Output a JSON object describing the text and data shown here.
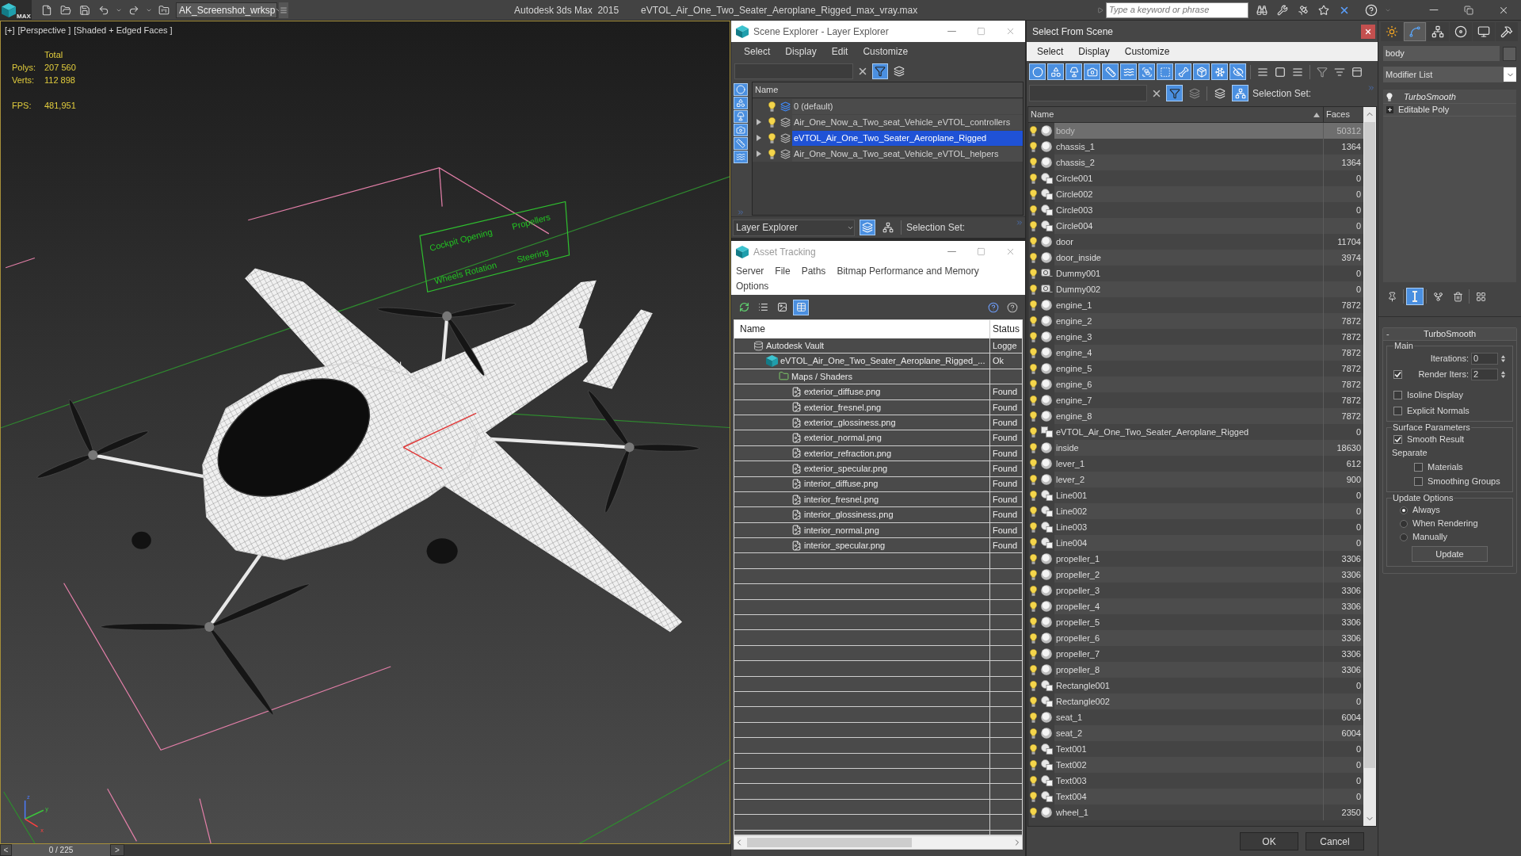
{
  "title_bar": {
    "logo": "MAX",
    "workspace": "AK_Screenshot_wrksp",
    "app_title": "Autodesk 3ds Max  2015",
    "file_title": "eVTOL_Air_One_Two_Seater_Aeroplane_Rigged_max_vray.max",
    "search": {
      "placeholder": "Type a keyword or phrase"
    }
  },
  "viewport": {
    "labels": [
      "[+]",
      "[Perspective ]",
      "[Shaded + Edged Faces ]"
    ],
    "stats": {
      "heading": "Total",
      "rows": [
        {
          "label": "Polys:",
          "value": "207 560"
        },
        {
          "label": "Verts:",
          "value": "112 898"
        }
      ],
      "fps": {
        "label": "FPS:",
        "value": "481,951"
      }
    },
    "rig_labels": [
      "Cockpit Opening",
      "Propellers",
      "Wheels Rotation",
      "Steering"
    ],
    "axis_labels": [
      "z",
      "y",
      "x"
    ]
  },
  "time_slider": {
    "prev": "<",
    "position": "0 / 225",
    "next": ">"
  },
  "scene_explorer": {
    "title": "Scene Explorer - Layer Explorer",
    "menu": [
      "Select",
      "Display",
      "Edit",
      "Customize"
    ],
    "filter_on": true,
    "type_filters": [
      {
        "on": true
      },
      {
        "on": true
      },
      {
        "on": true
      },
      {
        "on": true
      },
      {
        "on": true
      },
      {
        "on": true
      }
    ],
    "column": "Name",
    "layers": [
      {
        "name": "0 (default)",
        "expandable": false,
        "current": true,
        "selected": false
      },
      {
        "name": "Air_One_Now_a_Two_seat_Vehicle_eVTOL_controllers",
        "expandable": true,
        "current": false,
        "selected": false
      },
      {
        "name": "eVTOL_Air_One_Two_Seater_Aeroplane_Rigged",
        "expandable": true,
        "current": false,
        "selected": true
      },
      {
        "name": "Air_One_Now_a_Two_seat_Vehicle_eVTOL_helpers",
        "expandable": true,
        "current": false,
        "selected": false
      }
    ],
    "explorer_mode": "Layer Explorer",
    "view_toggles": [
      {
        "on": true
      },
      {
        "on": false
      }
    ],
    "selection_set": "Selection Set:"
  },
  "asset_tracking": {
    "title": "Asset Tracking",
    "menu": [
      "Server",
      "File",
      "Paths",
      "Bitmap Performance and Memory",
      "Options"
    ],
    "view_modes": [
      {
        "selected": false
      },
      {
        "selected": false
      },
      {
        "selected": true
      }
    ],
    "columns": [
      "Name",
      "Status"
    ],
    "tree": [
      {
        "kind": "vault",
        "name": "Autodesk Vault",
        "status": "Logge",
        "children": [
          {
            "kind": "scene",
            "name": "eVTOL_Air_One_Two_Seater_Aeroplane_Rigged_...",
            "status": "Ok",
            "children": [
              {
                "kind": "folder",
                "name": "Maps / Shaders",
                "children": [
                  {
                    "kind": "bitmap",
                    "name": "exterior_diffuse.png",
                    "status": "Found"
                  },
                  {
                    "kind": "bitmap",
                    "name": "exterior_fresnel.png",
                    "status": "Found"
                  },
                  {
                    "kind": "bitmap",
                    "name": "exterior_glossiness.png",
                    "status": "Found"
                  },
                  {
                    "kind": "bitmap",
                    "name": "exterior_normal.png",
                    "status": "Found"
                  },
                  {
                    "kind": "bitmap",
                    "name": "exterior_refraction.png",
                    "status": "Found"
                  },
                  {
                    "kind": "bitmap",
                    "name": "exterior_specular.png",
                    "status": "Found"
                  },
                  {
                    "kind": "bitmap",
                    "name": "interior_diffuse.png",
                    "status": "Found"
                  },
                  {
                    "kind": "bitmap",
                    "name": "interior_fresnel.png",
                    "status": "Found"
                  },
                  {
                    "kind": "bitmap",
                    "name": "interior_glossiness.png",
                    "status": "Found"
                  },
                  {
                    "kind": "bitmap",
                    "name": "interior_normal.png",
                    "status": "Found"
                  },
                  {
                    "kind": "bitmap",
                    "name": "interior_specular.png",
                    "status": "Found"
                  }
                ]
              }
            ]
          }
        ]
      }
    ]
  },
  "select_from_scene": {
    "title": "Select From Scene",
    "menu": [
      "Select",
      "Display",
      "Customize"
    ],
    "type_filters": [
      {
        "on": true
      },
      {
        "on": true
      },
      {
        "on": true
      },
      {
        "on": true
      },
      {
        "on": true
      },
      {
        "on": true
      },
      {
        "on": true
      },
      {
        "on": true
      },
      {
        "on": true
      },
      {
        "on": true
      },
      {
        "on": true
      },
      {
        "on": true
      }
    ],
    "toggles": [
      {
        "on": true
      },
      {
        "on": false
      },
      {
        "on": true
      }
    ],
    "selection_set": "Selection Set:",
    "columns": [
      "Name",
      "Faces"
    ],
    "rows": [
      {
        "name": "body",
        "faces": "50312",
        "kind": "geometry",
        "selected": true
      },
      {
        "name": "chassis_1",
        "faces": "1364",
        "kind": "geometry",
        "selected": false
      },
      {
        "name": "chassis_2",
        "faces": "1364",
        "kind": "geometry",
        "selected": false
      },
      {
        "name": "Circle001",
        "faces": "0",
        "kind": "shape",
        "selected": false
      },
      {
        "name": "Circle002",
        "faces": "0",
        "kind": "shape",
        "selected": false
      },
      {
        "name": "Circle003",
        "faces": "0",
        "kind": "shape",
        "selected": false
      },
      {
        "name": "Circle004",
        "faces": "0",
        "kind": "shape",
        "selected": false
      },
      {
        "name": "door",
        "faces": "11704",
        "kind": "geometry",
        "selected": false
      },
      {
        "name": "door_inside",
        "faces": "3974",
        "kind": "geometry",
        "selected": false
      },
      {
        "name": "Dummy001",
        "faces": "0",
        "kind": "helper",
        "selected": false
      },
      {
        "name": "Dummy002",
        "faces": "0",
        "kind": "helper",
        "selected": false
      },
      {
        "name": "engine_1",
        "faces": "7872",
        "kind": "geometry",
        "selected": false
      },
      {
        "name": "engine_2",
        "faces": "7872",
        "kind": "geometry",
        "selected": false
      },
      {
        "name": "engine_3",
        "faces": "7872",
        "kind": "geometry",
        "selected": false
      },
      {
        "name": "engine_4",
        "faces": "7872",
        "kind": "geometry",
        "selected": false
      },
      {
        "name": "engine_5",
        "faces": "7872",
        "kind": "geometry",
        "selected": false
      },
      {
        "name": "engine_6",
        "faces": "7872",
        "kind": "geometry",
        "selected": false
      },
      {
        "name": "engine_7",
        "faces": "7872",
        "kind": "geometry",
        "selected": false
      },
      {
        "name": "engine_8",
        "faces": "7872",
        "kind": "geometry",
        "selected": false
      },
      {
        "name": "eVTOL_Air_One_Two_Seater_Aeroplane_Rigged",
        "faces": "0",
        "kind": "group",
        "selected": false
      },
      {
        "name": "inside",
        "faces": "18630",
        "kind": "geometry",
        "selected": false
      },
      {
        "name": "lever_1",
        "faces": "612",
        "kind": "geometry",
        "selected": false
      },
      {
        "name": "lever_2",
        "faces": "900",
        "kind": "geometry",
        "selected": false
      },
      {
        "name": "Line001",
        "faces": "0",
        "kind": "shape",
        "selected": false
      },
      {
        "name": "Line002",
        "faces": "0",
        "kind": "shape",
        "selected": false
      },
      {
        "name": "Line003",
        "faces": "0",
        "kind": "shape",
        "selected": false
      },
      {
        "name": "Line004",
        "faces": "0",
        "kind": "shape",
        "selected": false
      },
      {
        "name": "propeller_1",
        "faces": "3306",
        "kind": "geometry",
        "selected": false
      },
      {
        "name": "propeller_2",
        "faces": "3306",
        "kind": "geometry",
        "selected": false
      },
      {
        "name": "propeller_3",
        "faces": "3306",
        "kind": "geometry",
        "selected": false
      },
      {
        "name": "propeller_4",
        "faces": "3306",
        "kind": "geometry",
        "selected": false
      },
      {
        "name": "propeller_5",
        "faces": "3306",
        "kind": "geometry",
        "selected": false
      },
      {
        "name": "propeller_6",
        "faces": "3306",
        "kind": "geometry",
        "selected": false
      },
      {
        "name": "propeller_7",
        "faces": "3306",
        "kind": "geometry",
        "selected": false
      },
      {
        "name": "propeller_8",
        "faces": "3306",
        "kind": "geometry",
        "selected": false
      },
      {
        "name": "Rectangle001",
        "faces": "0",
        "kind": "shape",
        "selected": false
      },
      {
        "name": "Rectangle002",
        "faces": "0",
        "kind": "shape",
        "selected": false
      },
      {
        "name": "seat_1",
        "faces": "6004",
        "kind": "geometry",
        "selected": false
      },
      {
        "name": "seat_2",
        "faces": "6004",
        "kind": "geometry",
        "selected": false
      },
      {
        "name": "Text001",
        "faces": "0",
        "kind": "shape",
        "selected": false
      },
      {
        "name": "Text002",
        "faces": "0",
        "kind": "shape",
        "selected": false
      },
      {
        "name": "Text003",
        "faces": "0",
        "kind": "shape",
        "selected": false
      },
      {
        "name": "Text004",
        "faces": "0",
        "kind": "shape",
        "selected": false
      },
      {
        "name": "wheel_1",
        "faces": "2350",
        "kind": "geometry",
        "selected": false
      }
    ],
    "buttons": [
      "OK",
      "Cancel"
    ]
  },
  "command_panel": {
    "tabs": [
      {
        "selected": false
      },
      {
        "selected": true
      },
      {
        "selected": false
      },
      {
        "selected": false
      },
      {
        "selected": false
      },
      {
        "selected": false
      }
    ],
    "object_name": "body",
    "modifier_list": "Modifier List",
    "stack": [
      {
        "kind": "modifier",
        "name": "TurboSmooth"
      },
      {
        "kind": "base",
        "name": "Editable Poly"
      }
    ],
    "show_end_result": true,
    "rollout": {
      "title": "TurboSmooth",
      "collapse": "-",
      "main": {
        "label": "Main",
        "iterations": {
          "label": "Iterations:",
          "value": "0"
        },
        "render_iters": {
          "label": "Render Iters:",
          "checked": true,
          "value": "2"
        },
        "options": [
          {
            "label": "Isoline Display",
            "checked": false
          },
          {
            "label": "Explicit Normals",
            "checked": false
          }
        ]
      },
      "surface": {
        "label": "Surface Parameters",
        "smooth_result": {
          "label": "Smooth Result",
          "checked": true
        },
        "separate_label": "Separate",
        "separate": [
          {
            "label": "Materials",
            "checked": false
          },
          {
            "label": "Smoothing Groups",
            "checked": false
          }
        ]
      },
      "update": {
        "label": "Update Options",
        "options": [
          {
            "label": "Always",
            "selected": true
          },
          {
            "label": "When Rendering",
            "selected": false
          },
          {
            "label": "Manually",
            "selected": false
          }
        ],
        "button": "Update"
      }
    }
  }
}
